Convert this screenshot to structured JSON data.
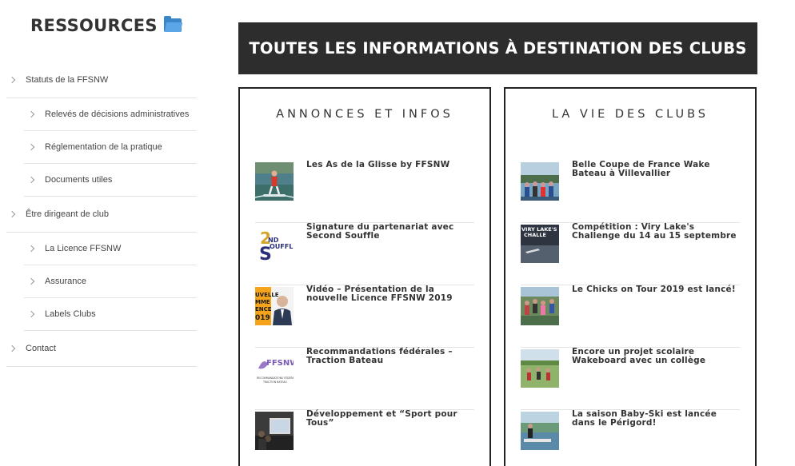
{
  "sidebar": {
    "title": "RESSOURCES",
    "icon": "folder-icon",
    "items": [
      {
        "label": "Statuts de la FFSNW",
        "level": "top"
      },
      {
        "label": "Relevés de décisions administratives",
        "level": "sub"
      },
      {
        "label": "Réglementation de la pratique",
        "level": "sub"
      },
      {
        "label": "Documents utiles",
        "level": "sub"
      },
      {
        "label": "Être dirigeant de club",
        "level": "top"
      },
      {
        "label": "La Licence FFSNW",
        "level": "sub"
      },
      {
        "label": "Assurance",
        "level": "sub"
      },
      {
        "label": "Labels Clubs",
        "level": "sub"
      },
      {
        "label": "Contact",
        "level": "top"
      }
    ]
  },
  "banner": {
    "title": "TOUTES LES INFORMATIONS À DESTINATION DES CLUBS"
  },
  "panels": [
    {
      "title": "ANNONCES ET INFOS",
      "posts": [
        {
          "title": "Les As de la Glisse by FFSNW"
        },
        {
          "title": "Signature du partenariat avec Second Souffle"
        },
        {
          "title": "Vidéo – Présentation de la nouvelle Licence FFSNW 2019"
        },
        {
          "title": "Recommandations fédérales – Traction Bateau"
        },
        {
          "title": "Développement et “Sport pour Tous”"
        }
      ]
    },
    {
      "title": "LA VIE DES CLUBS",
      "posts": [
        {
          "title": "Belle Coupe de France Wake Bateau à Villevallier"
        },
        {
          "title": "Compétition : Viry Lake's Challenge du 14 au 15 septembre"
        },
        {
          "title": "Le Chicks on Tour 2019 est lancé!"
        },
        {
          "title": "Encore un projet scolaire Wakeboard avec un collège"
        },
        {
          "title": "La saison Baby-Ski est lancée dans le Périgord!"
        }
      ]
    }
  ],
  "thumb_text": {
    "second_souffle": "2 ND SOUFFLE",
    "licence": "UVELLE MME ENCE 019",
    "ffsnw_logo": "FFSNW",
    "ffsnw_caption": "RECOMMANDATIONS FÉDÉRALES TRACTION BATEAU",
    "viry": "VIRY LAKE'S CHALLE"
  }
}
